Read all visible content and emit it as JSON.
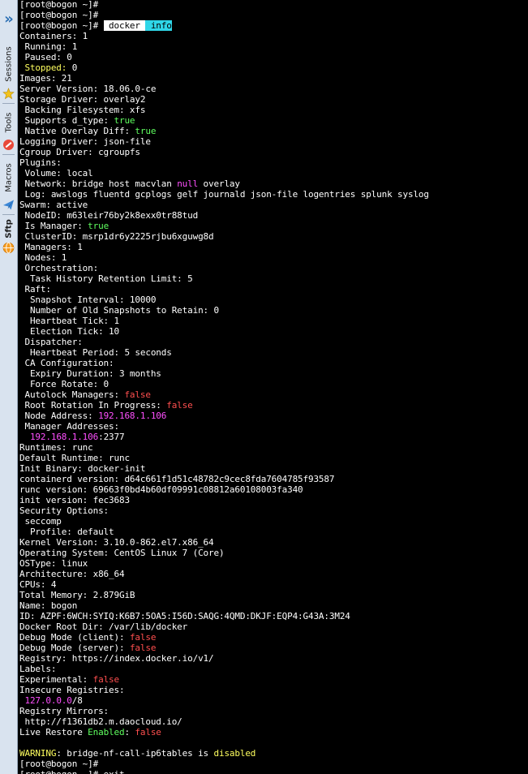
{
  "colors": {
    "background": "#000000",
    "text": "#ffffff",
    "green": "#5fff5f",
    "yellow": "#ffff5f",
    "red": "#ff4f4f",
    "magenta": "#ff4fff",
    "command_highlight": "#2fd6e8",
    "sidebar_bg": "#d9e3ef"
  },
  "sidebar": {
    "tabs": [
      {
        "label": "Sessions",
        "icon": "star-icon"
      },
      {
        "label": "Tools",
        "icon": "wrench-icon"
      },
      {
        "label": "Macros",
        "icon": "paper-plane-icon"
      },
      {
        "label": "Sftp",
        "icon": "globe-icon"
      }
    ]
  },
  "terminal": {
    "lines": [
      [
        {
          "t": "[root@bogon ~]#",
          "c": "white"
        }
      ],
      [
        {
          "t": "[root@bogon ~]#",
          "c": "white"
        }
      ],
      [
        {
          "t": "[root@bogon ~]# ",
          "c": "white"
        },
        {
          "t": " docker ",
          "c": "hl"
        },
        {
          "t": " info",
          "c": "hl2"
        }
      ],
      [
        {
          "t": "Containers: 1",
          "c": "white"
        }
      ],
      [
        {
          "t": " Running: 1",
          "c": "white"
        }
      ],
      [
        {
          "t": " Paused: 0",
          "c": "white"
        }
      ],
      [
        {
          "t": " Stopped: ",
          "c": "yellow"
        },
        {
          "t": "0",
          "c": "white"
        }
      ],
      [
        {
          "t": "Images: 21",
          "c": "white"
        }
      ],
      [
        {
          "t": "Server Version: 18.06.0-ce",
          "c": "white"
        }
      ],
      [
        {
          "t": "Storage Driver: overlay2",
          "c": "white"
        }
      ],
      [
        {
          "t": " Backing Filesystem: xfs",
          "c": "white"
        }
      ],
      [
        {
          "t": " Supports d_type: ",
          "c": "white"
        },
        {
          "t": "true",
          "c": "green"
        }
      ],
      [
        {
          "t": " Native Overlay Diff: ",
          "c": "white"
        },
        {
          "t": "true",
          "c": "green"
        }
      ],
      [
        {
          "t": "Logging Driver: json-file",
          "c": "white"
        }
      ],
      [
        {
          "t": "Cgroup Driver: cgroupfs",
          "c": "white"
        }
      ],
      [
        {
          "t": "Plugins:",
          "c": "white"
        }
      ],
      [
        {
          "t": " Volume: local",
          "c": "white"
        }
      ],
      [
        {
          "t": " Network: bridge host macvlan ",
          "c": "white"
        },
        {
          "t": "null",
          "c": "magenta"
        },
        {
          "t": " overlay",
          "c": "white"
        }
      ],
      [
        {
          "t": " Log: awslogs fluentd gcplogs gelf journald json-file logentries splunk syslog",
          "c": "white"
        }
      ],
      [
        {
          "t": "Swarm: active",
          "c": "white"
        }
      ],
      [
        {
          "t": " NodeID: m63leir76by2k8exx0tr88tud",
          "c": "white"
        }
      ],
      [
        {
          "t": " Is Manager: ",
          "c": "white"
        },
        {
          "t": "true",
          "c": "green"
        }
      ],
      [
        {
          "t": " ClusterID: msrp1dr6y2225rjbu6xguwg8d",
          "c": "white"
        }
      ],
      [
        {
          "t": " Managers: 1",
          "c": "white"
        }
      ],
      [
        {
          "t": " Nodes: 1",
          "c": "white"
        }
      ],
      [
        {
          "t": " Orchestration:",
          "c": "white"
        }
      ],
      [
        {
          "t": "  Task History Retention Limit: 5",
          "c": "white"
        }
      ],
      [
        {
          "t": " Raft:",
          "c": "white"
        }
      ],
      [
        {
          "t": "  Snapshot Interval: 10000",
          "c": "white"
        }
      ],
      [
        {
          "t": "  Number of Old Snapshots to Retain: 0",
          "c": "white"
        }
      ],
      [
        {
          "t": "  Heartbeat Tick: 1",
          "c": "white"
        }
      ],
      [
        {
          "t": "  Election Tick: 10",
          "c": "white"
        }
      ],
      [
        {
          "t": " Dispatcher:",
          "c": "white"
        }
      ],
      [
        {
          "t": "  Heartbeat Period: 5 seconds",
          "c": "white"
        }
      ],
      [
        {
          "t": " CA Configuration:",
          "c": "white"
        }
      ],
      [
        {
          "t": "  Expiry Duration: 3 months",
          "c": "white"
        }
      ],
      [
        {
          "t": "  Force Rotate: 0",
          "c": "white"
        }
      ],
      [
        {
          "t": " Autolock Managers: ",
          "c": "white"
        },
        {
          "t": "false",
          "c": "red"
        }
      ],
      [
        {
          "t": " Root Rotation In Progress: ",
          "c": "white"
        },
        {
          "t": "false",
          "c": "red"
        }
      ],
      [
        {
          "t": " Node Address: ",
          "c": "white"
        },
        {
          "t": "192.168.1.106",
          "c": "magenta"
        }
      ],
      [
        {
          "t": " Manager Addresses:",
          "c": "white"
        }
      ],
      [
        {
          "t": "  ",
          "c": "white"
        },
        {
          "t": "192.168.1.106",
          "c": "magenta"
        },
        {
          "t": ":2377",
          "c": "white"
        }
      ],
      [
        {
          "t": "Runtimes: runc",
          "c": "white"
        }
      ],
      [
        {
          "t": "Default Runtime: runc",
          "c": "white"
        }
      ],
      [
        {
          "t": "Init Binary: docker-init",
          "c": "white"
        }
      ],
      [
        {
          "t": "containerd version: d64c661f1d51c48782c9cec8fda7604785f93587",
          "c": "white"
        }
      ],
      [
        {
          "t": "runc version: 69663f0bd4b60df09991c08812a60108003fa340",
          "c": "white"
        }
      ],
      [
        {
          "t": "init version: fec3683",
          "c": "white"
        }
      ],
      [
        {
          "t": "Security Options:",
          "c": "white"
        }
      ],
      [
        {
          "t": " seccomp",
          "c": "white"
        }
      ],
      [
        {
          "t": "  Profile: default",
          "c": "white"
        }
      ],
      [
        {
          "t": "Kernel Version: 3.10.0-862.el7.x86_64",
          "c": "white"
        }
      ],
      [
        {
          "t": "Operating System: CentOS Linux 7 (Core)",
          "c": "white"
        }
      ],
      [
        {
          "t": "OSType: linux",
          "c": "white"
        }
      ],
      [
        {
          "t": "Architecture: x86_64",
          "c": "white"
        }
      ],
      [
        {
          "t": "CPUs: 4",
          "c": "white"
        }
      ],
      [
        {
          "t": "Total Memory: 2.879GiB",
          "c": "white"
        }
      ],
      [
        {
          "t": "Name: bogon",
          "c": "white"
        }
      ],
      [
        {
          "t": "ID: AZPF:6WCH:SYIQ:K6B7:5OA5:I56D:SAQG:4QMD:DKJF:EQP4:G43A:3M24",
          "c": "white"
        }
      ],
      [
        {
          "t": "Docker Root Dir: /var/lib/docker",
          "c": "white"
        }
      ],
      [
        {
          "t": "Debug Mode (client): ",
          "c": "white"
        },
        {
          "t": "false",
          "c": "red"
        }
      ],
      [
        {
          "t": "Debug Mode (server): ",
          "c": "white"
        },
        {
          "t": "false",
          "c": "red"
        }
      ],
      [
        {
          "t": "Registry: https://index.docker.io/v1/",
          "c": "white"
        }
      ],
      [
        {
          "t": "Labels:",
          "c": "white"
        }
      ],
      [
        {
          "t": "Experimental: ",
          "c": "white"
        },
        {
          "t": "false",
          "c": "red"
        }
      ],
      [
        {
          "t": "Insecure Registries:",
          "c": "white"
        }
      ],
      [
        {
          "t": " ",
          "c": "white"
        },
        {
          "t": "127.0.0.0",
          "c": "magenta"
        },
        {
          "t": "/8",
          "c": "white"
        }
      ],
      [
        {
          "t": "Registry Mirrors:",
          "c": "white"
        }
      ],
      [
        {
          "t": " http://f1361db2.m.daocloud.io/",
          "c": "white"
        }
      ],
      [
        {
          "t": "Live Restore ",
          "c": "white"
        },
        {
          "t": "Enabled",
          "c": "green"
        },
        {
          "t": ": ",
          "c": "white"
        },
        {
          "t": "false",
          "c": "red"
        }
      ],
      [
        {
          "t": "",
          "c": "white"
        }
      ],
      [
        {
          "t": "WARNING",
          "c": "yellow"
        },
        {
          "t": ": bridge-nf-call-ip6tables is ",
          "c": "white"
        },
        {
          "t": "disabled",
          "c": "yellow"
        }
      ],
      [
        {
          "t": "[root@bogon ~]#",
          "c": "white"
        }
      ],
      [
        {
          "t": "[root@bogon ~]# exit",
          "c": "white"
        }
      ]
    ]
  }
}
